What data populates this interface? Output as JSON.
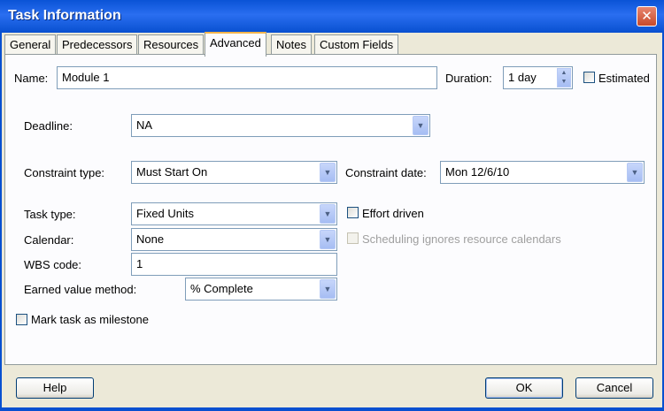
{
  "window": {
    "title": "Task Information"
  },
  "tabs": [
    "General",
    "Predecessors",
    "Resources",
    "Advanced",
    "Notes",
    "Custom Fields"
  ],
  "active_tab": "Advanced",
  "fields": {
    "name_label": "Name:",
    "name_value": "Module 1",
    "duration_label": "Duration:",
    "duration_value": "1 day",
    "estimated_label": "Estimated",
    "deadline_label": "Deadline:",
    "deadline_value": "NA",
    "constraint_type_label": "Constraint type:",
    "constraint_type_value": "Must Start On",
    "constraint_date_label": "Constraint date:",
    "constraint_date_value": "Mon 12/6/10",
    "task_type_label": "Task type:",
    "task_type_value": "Fixed Units",
    "effort_driven_label": "Effort driven",
    "calendar_label": "Calendar:",
    "calendar_value": "None",
    "scheduling_ignores_label": "Scheduling ignores resource calendars",
    "wbs_label": "WBS code:",
    "wbs_value": "1",
    "earned_value_label": "Earned value method:",
    "earned_value_value": "% Complete",
    "milestone_label": "Mark task as milestone"
  },
  "buttons": {
    "help": "Help",
    "ok": "OK",
    "cancel": "Cancel"
  },
  "icons": {
    "close": "close-icon",
    "dropdown": "chevron-down-icon",
    "spinner": "spinner-icon"
  }
}
